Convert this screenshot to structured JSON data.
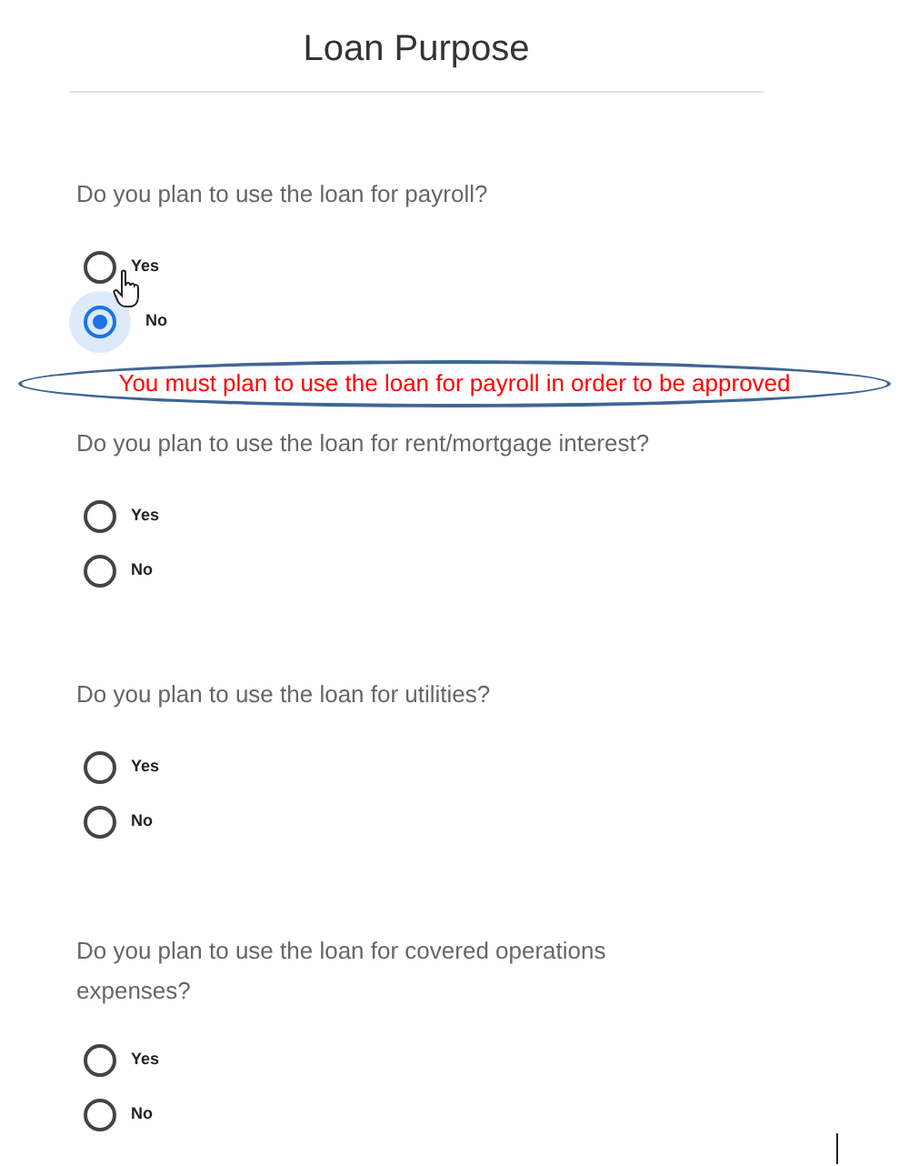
{
  "title": "Loan Purpose",
  "questions": [
    {
      "text": "Do you plan to use the loan for payroll?",
      "options": [
        {
          "label": "Yes",
          "selected": false
        },
        {
          "label": "No",
          "selected": true
        }
      ]
    },
    {
      "text": "Do you plan to use the loan for rent/mortgage interest?",
      "options": [
        {
          "label": "Yes",
          "selected": false
        },
        {
          "label": "No",
          "selected": false
        }
      ]
    },
    {
      "text": "Do you plan to use the loan for utilities?",
      "options": [
        {
          "label": "Yes",
          "selected": false
        },
        {
          "label": "No",
          "selected": false
        }
      ]
    },
    {
      "text": "Do you plan to use the loan for covered operations expenses?",
      "options": [
        {
          "label": "Yes",
          "selected": false
        },
        {
          "label": "No",
          "selected": false
        }
      ]
    }
  ],
  "annotation": {
    "text": "You must plan to use the loan for payroll in order to be approved"
  }
}
